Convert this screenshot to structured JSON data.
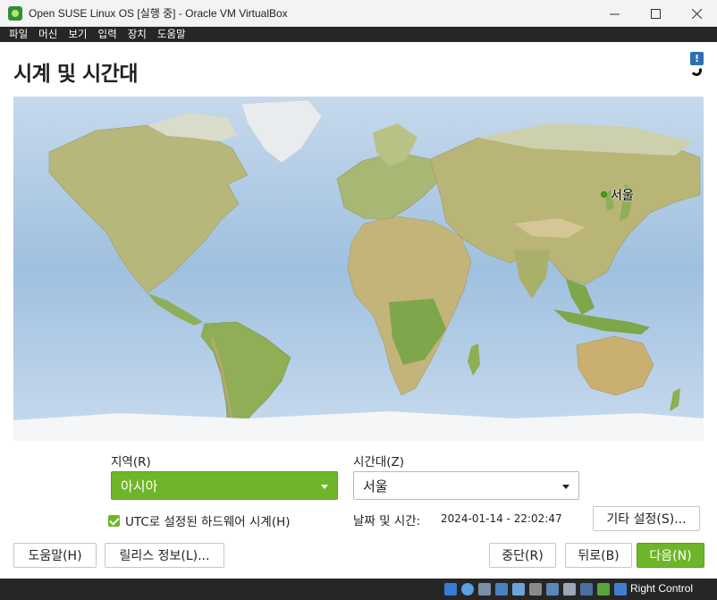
{
  "window": {
    "title": "Open SUSE Linux OS  [실행 중] - Oracle VM VirtualBox"
  },
  "menubar": {
    "items": [
      "파일",
      "머신",
      "보기",
      "입력",
      "장치",
      "도움말"
    ]
  },
  "page": {
    "title": "시계 및 시간대"
  },
  "map": {
    "selected_city": "서울"
  },
  "region": {
    "label": "지역(R)",
    "value": "아시아"
  },
  "timezone": {
    "label": "시간대(Z)",
    "value": "서울"
  },
  "utc": {
    "label": "UTC로 설정된 하드웨어 시계(H)",
    "checked": true
  },
  "datetime": {
    "label": "날짜 및 시간:",
    "value": "2024-01-14 - 22:02:47"
  },
  "buttons": {
    "other_settings": "기타 설정(S)...",
    "help": "도움말(H)",
    "release_notes": "릴리스 정보(L)...",
    "abort": "중단(R)",
    "back": "뒤로(B)",
    "next": "다음(N)"
  },
  "statusbar": {
    "host_key": "Right Control"
  },
  "colors": {
    "accent": "#6fb529",
    "ocean": "#bcd3e9",
    "land": "#b9b77d",
    "vbox_bar": "#262626"
  },
  "icons": {
    "app": "virtualbox-icon",
    "help": "help-icon",
    "dropdown": "chevron-down-icon",
    "checkbox": "check-icon"
  }
}
